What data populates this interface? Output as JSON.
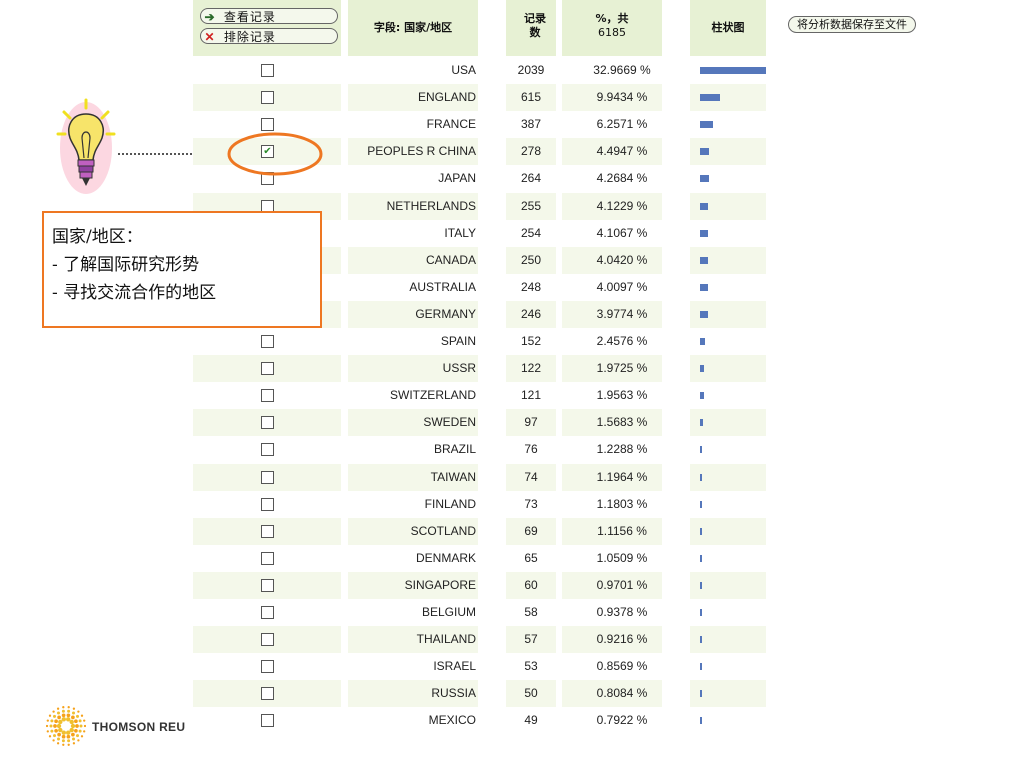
{
  "header": {
    "view_records_label": "查看记录",
    "exclude_records_label": "排除记录",
    "field_label": "字段: 国家/地区",
    "records_label": "记录数",
    "percent_label": "%，共",
    "percent_total": "6185",
    "bar_chart_label": "柱状图",
    "save_label": "将分析数据保存至文件"
  },
  "callout": {
    "title": "国家/地区：",
    "lines": [
      "- 了解国际研究形势",
      "- 寻找交流合作的地区"
    ]
  },
  "logo": {
    "text": "THOMSON REU"
  },
  "colors": {
    "header_bg": "#e7f1d4",
    "band": "#f4f8ea",
    "bar": "#5577bb",
    "highlight": "#ee7722"
  },
  "rows": [
    {
      "country": "USA",
      "count": "2039",
      "percent": "32.9669 %",
      "share": 0.329669,
      "checked": false
    },
    {
      "country": "ENGLAND",
      "count": "615",
      "percent": "9.9434 %",
      "share": 0.099434,
      "checked": false
    },
    {
      "country": "FRANCE",
      "count": "387",
      "percent": "6.2571 %",
      "share": 0.062571,
      "checked": false
    },
    {
      "country": "PEOPLES R CHINA",
      "count": "278",
      "percent": "4.4947 %",
      "share": 0.044947,
      "checked": true
    },
    {
      "country": "JAPAN",
      "count": "264",
      "percent": "4.2684 %",
      "share": 0.042684,
      "checked": false
    },
    {
      "country": "NETHERLANDS",
      "count": "255",
      "percent": "4.1229 %",
      "share": 0.041229,
      "checked": false
    },
    {
      "country": "ITALY",
      "count": "254",
      "percent": "4.1067 %",
      "share": 0.041067,
      "checked": false
    },
    {
      "country": "CANADA",
      "count": "250",
      "percent": "4.0420 %",
      "share": 0.04042,
      "checked": false
    },
    {
      "country": "AUSTRALIA",
      "count": "248",
      "percent": "4.0097 %",
      "share": 0.040097,
      "checked": false
    },
    {
      "country": "GERMANY",
      "count": "246",
      "percent": "3.9774 %",
      "share": 0.039774,
      "checked": false
    },
    {
      "country": "SPAIN",
      "count": "152",
      "percent": "2.4576 %",
      "share": 0.024576,
      "checked": false
    },
    {
      "country": "USSR",
      "count": "122",
      "percent": "1.9725 %",
      "share": 0.019725,
      "checked": false
    },
    {
      "country": "SWITZERLAND",
      "count": "121",
      "percent": "1.9563 %",
      "share": 0.019563,
      "checked": false
    },
    {
      "country": "SWEDEN",
      "count": "97",
      "percent": "1.5683 %",
      "share": 0.015683,
      "checked": false
    },
    {
      "country": "BRAZIL",
      "count": "76",
      "percent": "1.2288 %",
      "share": 0.012288,
      "checked": false
    },
    {
      "country": "TAIWAN",
      "count": "74",
      "percent": "1.1964 %",
      "share": 0.011964,
      "checked": false
    },
    {
      "country": "FINLAND",
      "count": "73",
      "percent": "1.1803 %",
      "share": 0.011803,
      "checked": false
    },
    {
      "country": "SCOTLAND",
      "count": "69",
      "percent": "1.1156 %",
      "share": 0.011156,
      "checked": false
    },
    {
      "country": "DENMARK",
      "count": "65",
      "percent": "1.0509 %",
      "share": 0.010509,
      "checked": false
    },
    {
      "country": "SINGAPORE",
      "count": "60",
      "percent": "0.9701 %",
      "share": 0.009701,
      "checked": false
    },
    {
      "country": "BELGIUM",
      "count": "58",
      "percent": "0.9378 %",
      "share": 0.009378,
      "checked": false
    },
    {
      "country": "THAILAND",
      "count": "57",
      "percent": "0.9216 %",
      "share": 0.009216,
      "checked": false
    },
    {
      "country": "ISRAEL",
      "count": "53",
      "percent": "0.8569 %",
      "share": 0.008569,
      "checked": false
    },
    {
      "country": "RUSSIA",
      "count": "50",
      "percent": "0.8084 %",
      "share": 0.008084,
      "checked": false
    },
    {
      "country": "MEXICO",
      "count": "49",
      "percent": "0.7922 %",
      "share": 0.007922,
      "checked": false
    }
  ]
}
